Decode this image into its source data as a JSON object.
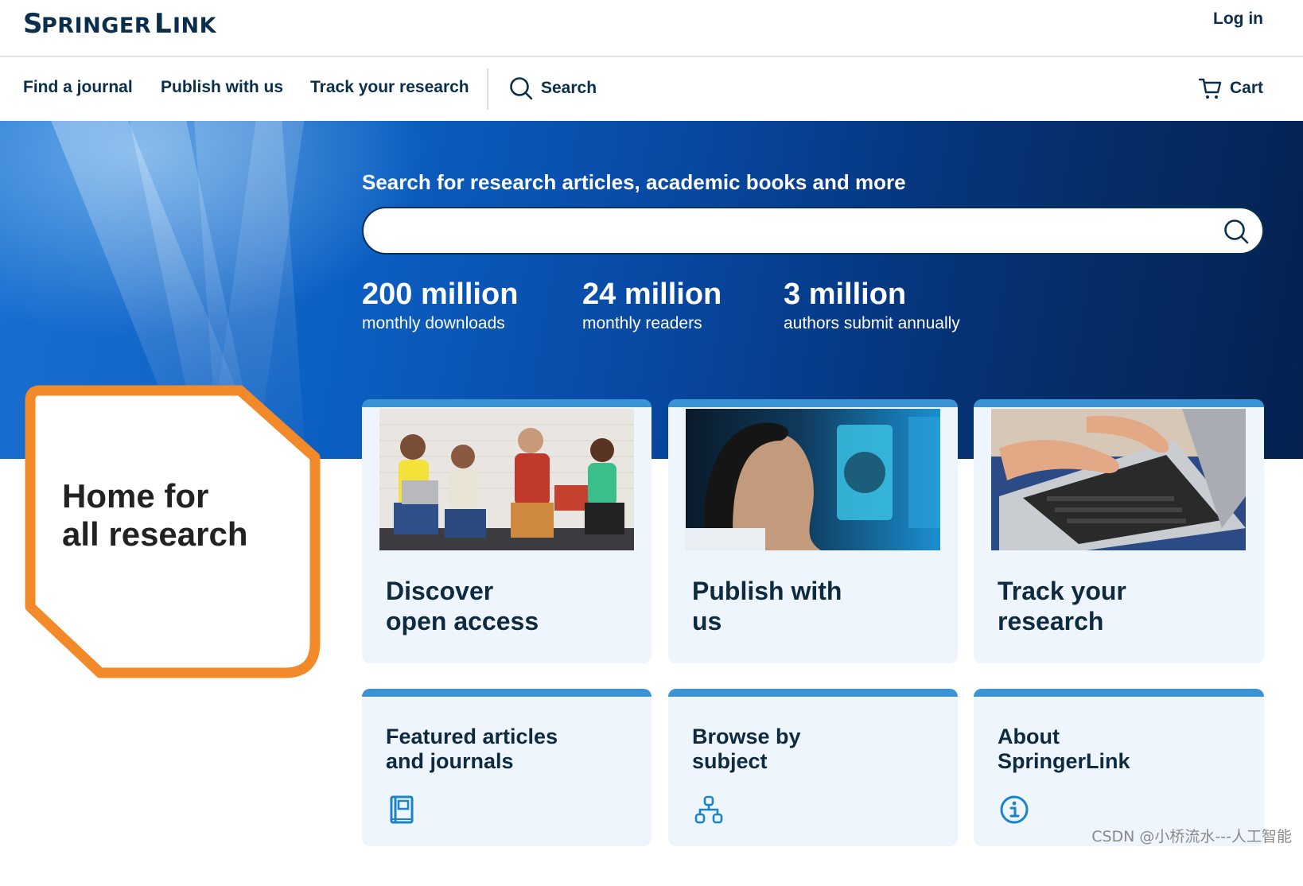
{
  "brand": {
    "logo_text": "Springer Link"
  },
  "header": {
    "login_label": "Log in"
  },
  "nav": {
    "items": [
      {
        "label": "Find a journal"
      },
      {
        "label": "Publish with us"
      },
      {
        "label": "Track your research"
      }
    ],
    "search_label": "Search",
    "cart_label": "Cart"
  },
  "hero": {
    "title": "Search for research articles, academic books and more",
    "search_value": "",
    "stats": [
      {
        "value": "200 million",
        "label": "monthly downloads"
      },
      {
        "value": "24 million",
        "label": "monthly readers"
      },
      {
        "value": "3 million",
        "label": "authors submit annually"
      }
    ]
  },
  "home": {
    "line1": "Home for",
    "line2": "all research"
  },
  "cards": [
    {
      "title_line1": "Discover",
      "title_line2": "open access"
    },
    {
      "title_line1": "Publish with",
      "title_line2": "us"
    },
    {
      "title_line1": "Track your",
      "title_line2": "research"
    }
  ],
  "small_cards": [
    {
      "title_line1": "Featured articles",
      "title_line2": "and journals",
      "icon": "journal-icon"
    },
    {
      "title_line1": "Browse by",
      "title_line2": "subject",
      "icon": "subject-tree-icon"
    },
    {
      "title_line1": "About",
      "title_line2": "SpringerLink",
      "icon": "info-icon"
    }
  ],
  "watermark": "CSDN @小桥流水---人工智能",
  "colors": {
    "brand_navy": "#0a2f4c",
    "accent_blue": "#3a93d4",
    "highlight_orange": "#f28a2a",
    "card_bg": "#eef5fc"
  }
}
